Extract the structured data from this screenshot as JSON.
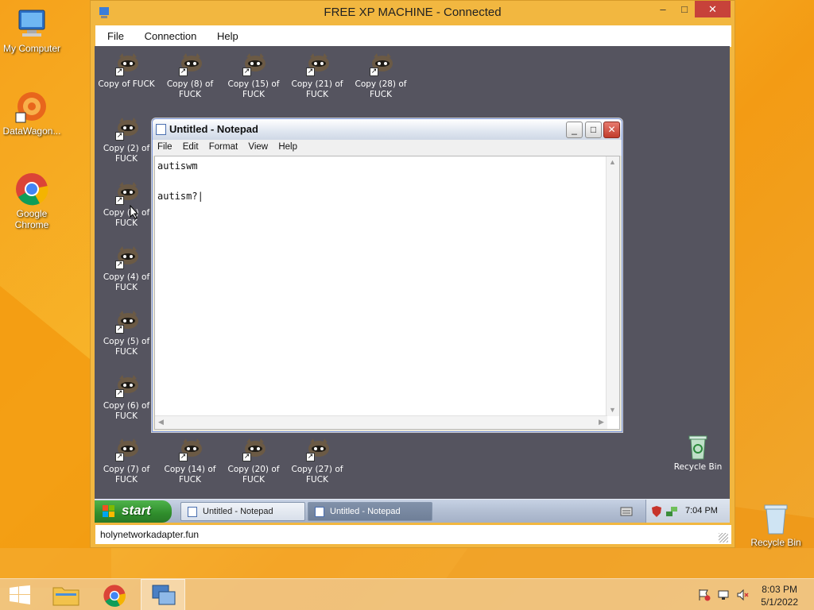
{
  "host_desktop": {
    "icons": [
      {
        "label": "My Computer",
        "icon": "computer-icon"
      },
      {
        "label": "DataWagon...",
        "icon": "datawagon-icon"
      },
      {
        "label": "Google Chrome",
        "icon": "chrome-icon"
      },
      {
        "label": "Recycle Bin",
        "icon": "recycle-bin-icon"
      }
    ]
  },
  "host_window": {
    "title": "FREE XP MACHINE - Connected",
    "menu": [
      "File",
      "Connection",
      "Help"
    ],
    "status_text": "holynetworkadapter.fun",
    "controls": {
      "minimize": "‒",
      "maximize": "□",
      "close": "✕"
    }
  },
  "xp_desktop": {
    "icons": [
      {
        "label": "Copy of FUCK"
      },
      {
        "label": "Copy (8) of FUCK"
      },
      {
        "label": "Copy (15) of FUCK"
      },
      {
        "label": "Copy (21) of FUCK"
      },
      {
        "label": "Copy (28) of FUCK"
      },
      {
        "label": "Copy (2) of FUCK"
      },
      {
        "label": "Copy (3) of FUCK"
      },
      {
        "label": "Copy (4) of FUCK"
      },
      {
        "label": "Copy (5) of FUCK"
      },
      {
        "label": "Copy (6) of FUCK"
      },
      {
        "label": "Copy (7) of FUCK"
      },
      {
        "label": "Copy (14) of FUCK"
      },
      {
        "label": "Copy (20) of FUCK"
      },
      {
        "label": "Copy (27) of FUCK"
      },
      {
        "label": "Recycle Bin"
      }
    ]
  },
  "notepad": {
    "title": "Untitled - Notepad",
    "menu": [
      "File",
      "Edit",
      "Format",
      "View",
      "Help"
    ],
    "text": "autiswm\n\nautism?|",
    "controls": {
      "minimize": "_",
      "maximize": "□",
      "close": "✕"
    }
  },
  "xp_taskbar": {
    "start_label": "start",
    "tasks": [
      {
        "label": "Untitled - Notepad",
        "active": false
      },
      {
        "label": "Untitled - Notepad",
        "active": true
      }
    ],
    "clock": "7:04 PM"
  },
  "host_taskbar": {
    "apps": [
      "file-explorer-icon",
      "chrome-icon",
      "remote-desktop-icon"
    ],
    "time": "8:03 PM",
    "date": "5/1/2022"
  }
}
